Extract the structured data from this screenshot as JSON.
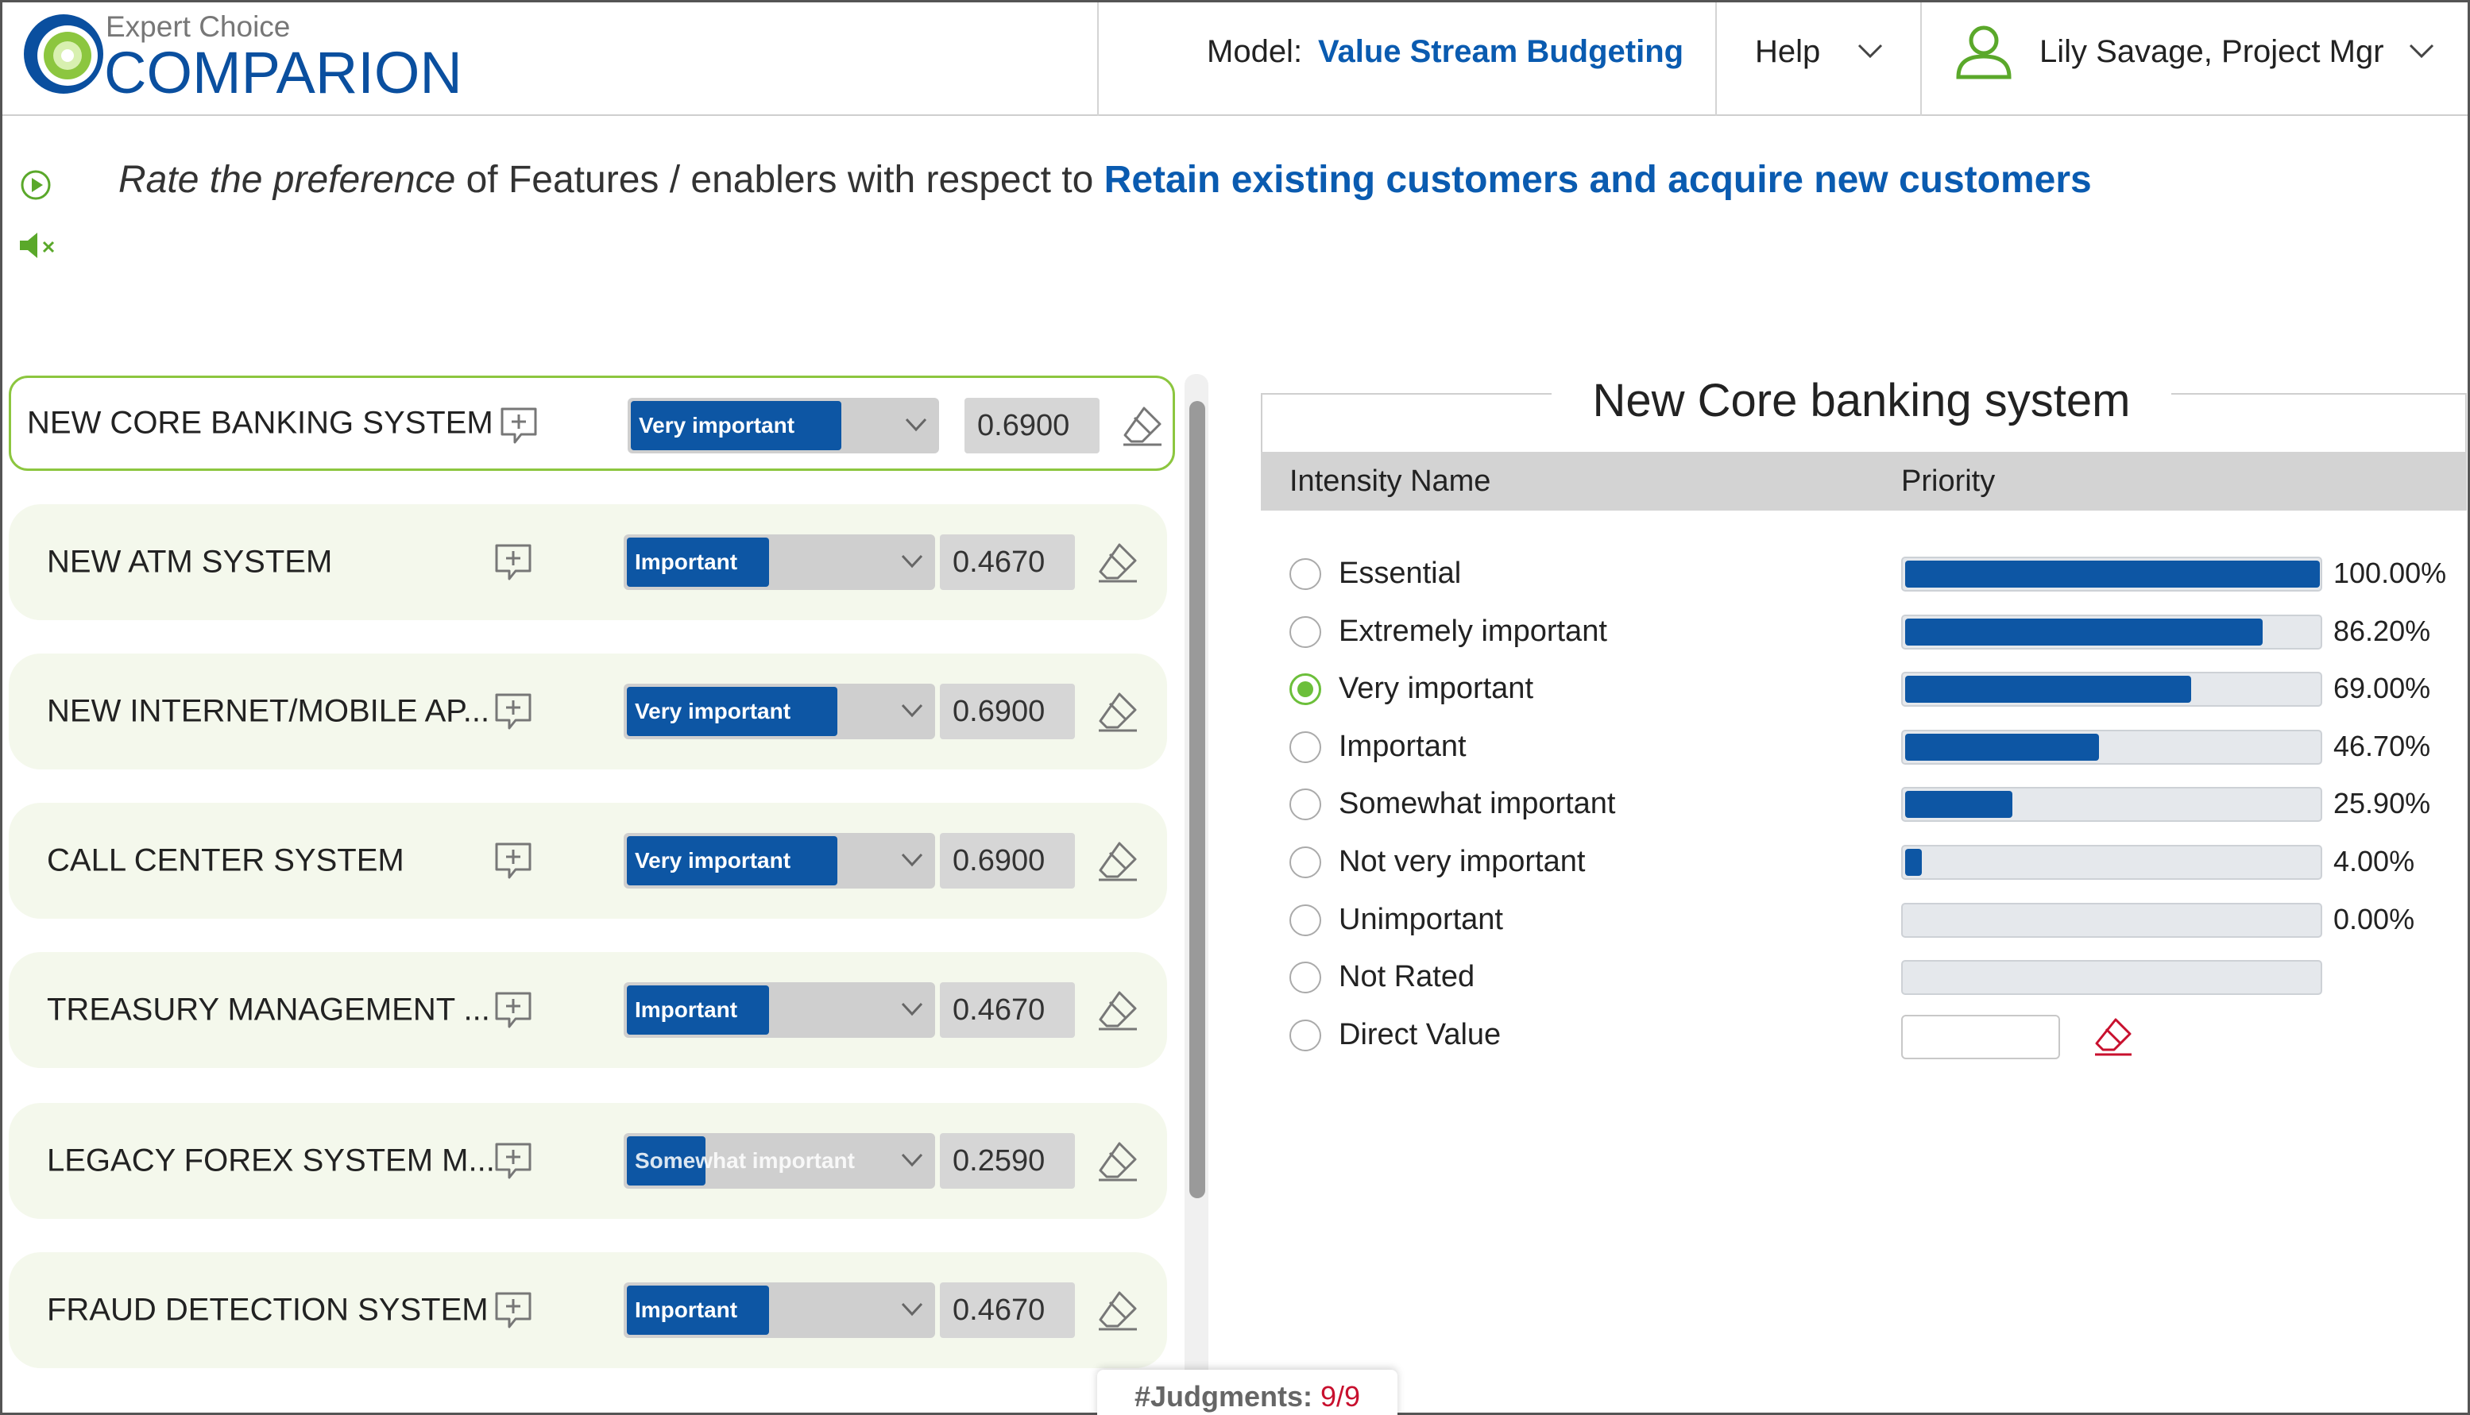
{
  "header": {
    "logo_top": "Expert Choice",
    "logo_main": "COMPARION",
    "model_label": "Model:",
    "model_name": "Value Stream Budgeting",
    "help_label": "Help",
    "user_label": "Lily Savage, Project Mgr"
  },
  "prompt": {
    "italic": "Rate the preference",
    "middle": " of Features / enablers with respect to ",
    "goal": "Retain existing customers and acquire new customers"
  },
  "items": [
    {
      "name": "NEW CORE BANKING SYSTEM",
      "rating": "Very important",
      "value": "0.6900",
      "fill": 0.69
    },
    {
      "name": "NEW ATM SYSTEM",
      "rating": "Important",
      "value": "0.4670",
      "fill": 0.467
    },
    {
      "name": "NEW INTERNET/MOBILE AP...",
      "rating": "Very important",
      "value": "0.6900",
      "fill": 0.69
    },
    {
      "name": "CALL CENTER SYSTEM",
      "rating": "Very important",
      "value": "0.6900",
      "fill": 0.69
    },
    {
      "name": "TREASURY MANAGEMENT ...",
      "rating": "Important",
      "value": "0.4670",
      "fill": 0.467
    },
    {
      "name": "LEGACY FOREX SYSTEM M...",
      "rating": "Somewhat important",
      "value": "0.2590",
      "fill": 0.259
    },
    {
      "name": "FRAUD DETECTION SYSTEM",
      "rating": "Important",
      "value": "0.4670",
      "fill": 0.467
    }
  ],
  "judgments": {
    "label": "#Judgments:",
    "value": "9/9"
  },
  "panel": {
    "title": "New Core banking system",
    "col_name": "Intensity Name",
    "col_priority": "Priority",
    "intensities": [
      {
        "name": "Essential",
        "priority": "100.00%",
        "fraction": 1.0,
        "selected": false
      },
      {
        "name": "Extremely important",
        "priority": "86.20%",
        "fraction": 0.862,
        "selected": false
      },
      {
        "name": "Very important",
        "priority": "69.00%",
        "fraction": 0.69,
        "selected": true
      },
      {
        "name": "Important",
        "priority": "46.70%",
        "fraction": 0.467,
        "selected": false
      },
      {
        "name": "Somewhat important",
        "priority": "25.90%",
        "fraction": 0.259,
        "selected": false
      },
      {
        "name": "Not very important",
        "priority": "4.00%",
        "fraction": 0.04,
        "selected": false
      },
      {
        "name": "Unimportant",
        "priority": "0.00%",
        "fraction": 0.0,
        "selected": false
      },
      {
        "name": "Not Rated",
        "priority": "",
        "fraction": 0.0,
        "selected": false
      },
      {
        "name": "Direct Value",
        "priority": "",
        "fraction": 0.0,
        "selected": false
      }
    ]
  },
  "colors": {
    "brand_blue": "#0a4f9f",
    "link_blue": "#0a5bb0",
    "bar_blue": "#0d56a4",
    "accent_green": "#6cbf3a",
    "judg_red": "#c8102e",
    "eraser_red": "#c8102e"
  }
}
